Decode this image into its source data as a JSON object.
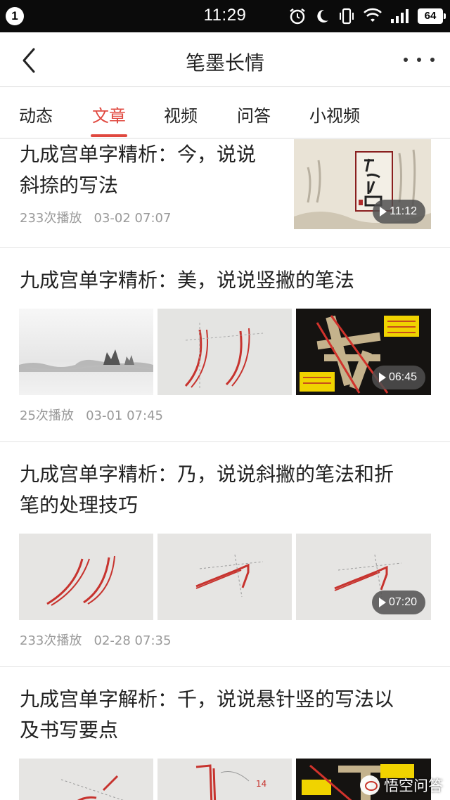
{
  "status_bar": {
    "notification_count": "1",
    "time": "11:29",
    "battery": "64",
    "icons": [
      "alarm-icon",
      "moon-icon",
      "vibrate-icon",
      "wifi-icon",
      "signal-icon",
      "battery-icon"
    ]
  },
  "header": {
    "title": "笔墨长情",
    "back_icon": "chevron-left-icon",
    "more_icon": "more-dots-icon"
  },
  "tabs": [
    {
      "label": "动态",
      "active": false
    },
    {
      "label": "文章",
      "active": true
    },
    {
      "label": "视频",
      "active": false
    },
    {
      "label": "问答",
      "active": false
    },
    {
      "label": "小视频",
      "active": false
    }
  ],
  "colors": {
    "accent": "#e0483f",
    "status_bar": "#0b0b0b",
    "meta_text": "#999999"
  },
  "articles": [
    {
      "title_line1": "九成宫单字精析：今，说说",
      "title_line2": "斜捺的写法",
      "meta": "233次播放   03-02 07:07",
      "duration": "11:12"
    },
    {
      "title_line1": "九成宫单字精析：美，说说竖撇的笔法",
      "meta": "25次播放   03-01 07:45",
      "duration": "06:45"
    },
    {
      "title_line1": "九成宫单字精析：乃，说说斜撇的笔法和折",
      "title_line2": "笔的处理技巧",
      "meta": "233次播放   02-28 07:35",
      "duration": "07:20"
    },
    {
      "title_line1": "九成宫单字解析：千，说说悬针竖的写法以",
      "title_line2": "及书写要点"
    }
  ],
  "watermark": {
    "text": "悟空问答",
    "icon": "wukong-logo-icon"
  }
}
